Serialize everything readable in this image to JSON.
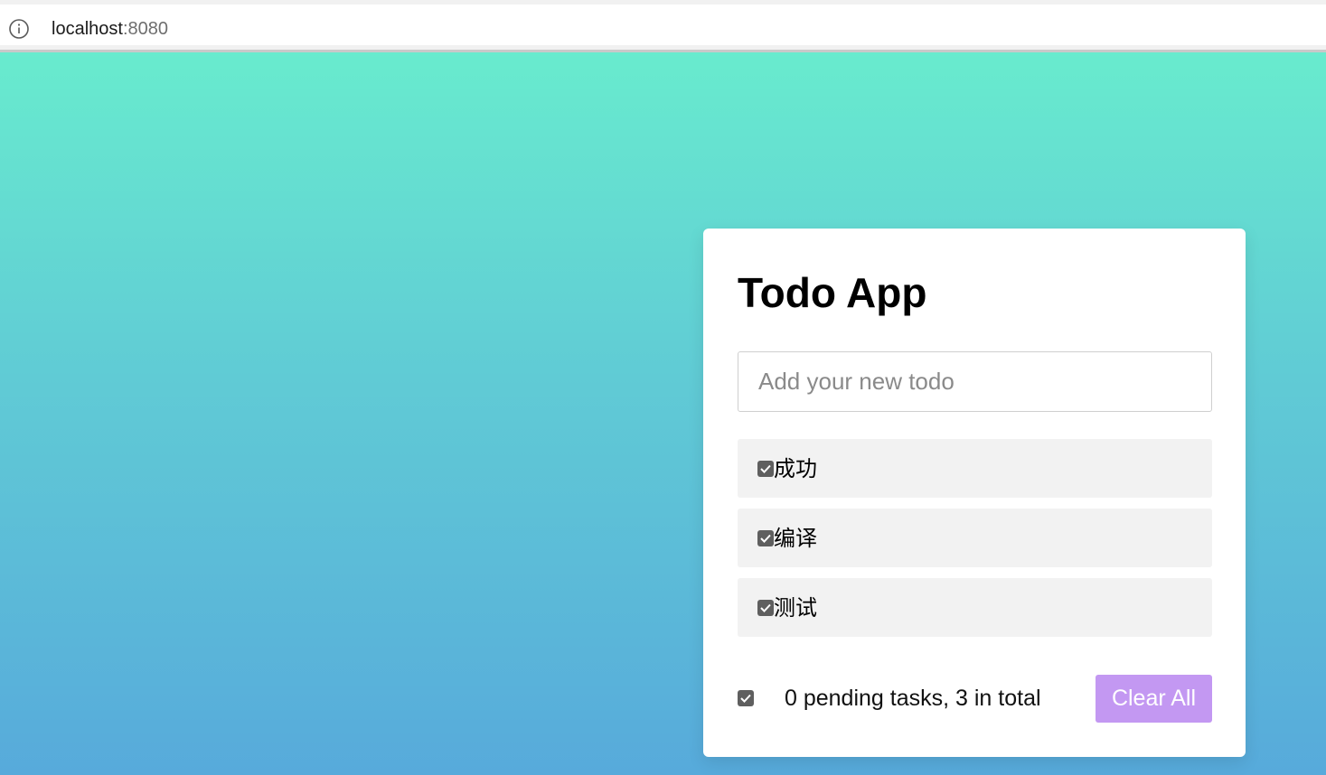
{
  "browser": {
    "host": "localhost",
    "port": ":8080"
  },
  "app": {
    "title": "Todo App",
    "input_placeholder": "Add your new todo",
    "todos": [
      {
        "label": "成功",
        "checked": true
      },
      {
        "label": "编译",
        "checked": true
      },
      {
        "label": "测试",
        "checked": true
      }
    ],
    "footer": {
      "pending_text": "0 pending tasks, 3 in total",
      "clear_label": "Clear All"
    }
  },
  "colors": {
    "gradient_top": "#68ebce",
    "gradient_bottom": "#57aadb",
    "clear_button": "#c398f2",
    "checkbox": "#5f5f5f"
  },
  "icons": {
    "address": "info-icon",
    "check": "checkmark-icon"
  }
}
